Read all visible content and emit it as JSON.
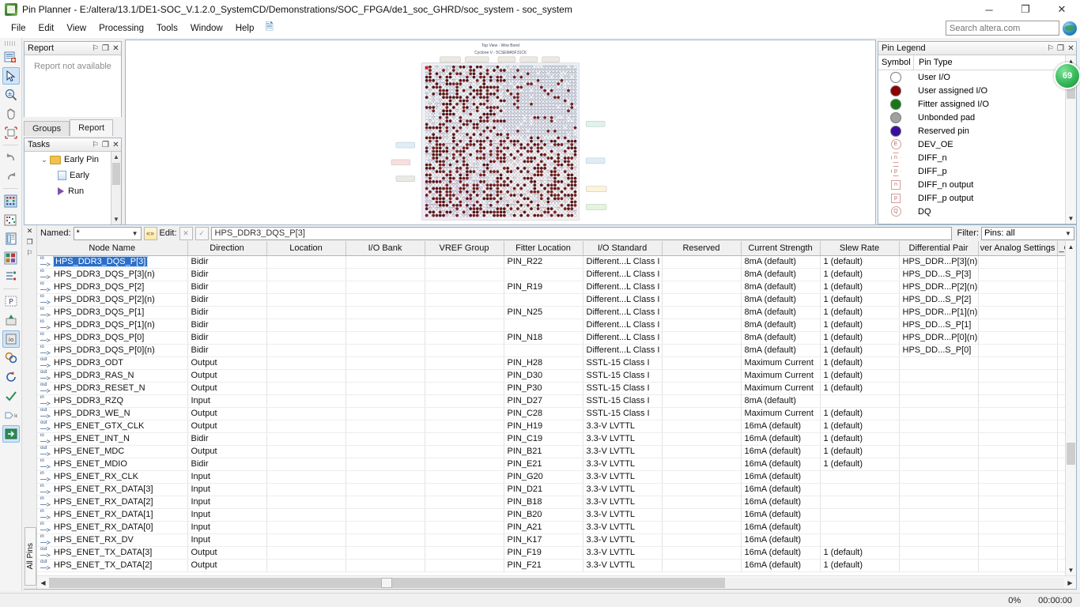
{
  "window": {
    "title": "Pin Planner - E:/altera/13.1/DE1-SOC_V.1.2.0_SystemCD/Demonstrations/SOC_FPGA/de1_soc_GHRD/soc_system - soc_system",
    "minimize": "─",
    "maximize": "❐",
    "close": "✕"
  },
  "menu": {
    "items": [
      "File",
      "Edit",
      "View",
      "Processing",
      "Tools",
      "Window",
      "Help"
    ],
    "note_icon": "notes-icon"
  },
  "search": {
    "placeholder": "Search altera.com",
    "value": "",
    "globe_icon": "globe-icon"
  },
  "left_toolbar": {
    "buttons": [
      {
        "name": "new-pin-report-icon"
      },
      {
        "name": "select-arrow-icon",
        "active": true
      },
      {
        "name": "zoom-icon"
      },
      {
        "name": "pan-hand-icon"
      },
      {
        "name": "zoom-fit-icon"
      },
      {
        "name": "undo-icon"
      },
      {
        "name": "redo-icon"
      },
      {
        "name": "package-view-icon"
      },
      {
        "name": "pad-view-icon"
      },
      {
        "name": "report-view-icon"
      },
      {
        "name": "resource-view-icon"
      },
      {
        "name": "tasks-view-icon"
      },
      {
        "name": "pin-legend-icon"
      },
      {
        "name": "highlight-icon"
      },
      {
        "name": "all-pins-view-icon",
        "active": true
      },
      {
        "name": "find-icon"
      },
      {
        "name": "refresh-icon"
      },
      {
        "name": "validate-icon"
      },
      {
        "name": "io-assignment-icon"
      },
      {
        "name": "export-icon",
        "active": true
      }
    ]
  },
  "report_panel": {
    "title": "Report",
    "message": "Report not available",
    "pin_icon": "⚐",
    "float_icon": "❐",
    "close_icon": "✕"
  },
  "dock_tabs": [
    {
      "label": "Groups",
      "selected": false
    },
    {
      "label": "Report",
      "selected": true
    }
  ],
  "tasks_panel": {
    "title": "Tasks",
    "pin_icon": "⚐",
    "float_icon": "❐",
    "close_icon": "✕",
    "tree": [
      {
        "label": "Early Pin",
        "icon": "folder-icon",
        "chevron": "⌄"
      },
      {
        "label": "Early",
        "icon": "page-icon",
        "chevron": ""
      },
      {
        "label": "Run ",
        "icon": "play-icon",
        "chevron": ""
      }
    ]
  },
  "chip_view": {
    "title_line1": "Top View - Wire Bond",
    "title_line2": "Cyclone V - 5CSEMA5F31C6"
  },
  "pin_legend": {
    "title": "Pin Legend",
    "pin_icon": "⚐",
    "float_icon": "❐",
    "close_icon": "✕",
    "headers": [
      "Symbol",
      "Pin Type"
    ],
    "rows": [
      {
        "label": "User I/O",
        "symbol": "circle",
        "color": "#ffffff",
        "glyph": ""
      },
      {
        "label": "User assigned I/O",
        "symbol": "circle",
        "color": "#8b0000",
        "glyph": ""
      },
      {
        "label": "Fitter assigned I/O",
        "symbol": "circle",
        "color": "#137a13",
        "glyph": ""
      },
      {
        "label": "Unbonded pad",
        "symbol": "circle",
        "color": "#a0a0a0",
        "glyph": ""
      },
      {
        "label": "Reserved pin",
        "symbol": "circle",
        "color": "#3a0d9e",
        "glyph": ""
      },
      {
        "label": "DEV_OE",
        "symbol": "circle-outline",
        "color": "#ffffff",
        "glyph": "E"
      },
      {
        "label": "DIFF_n",
        "symbol": "hex",
        "color": "#ffffff",
        "glyph": "n"
      },
      {
        "label": "DIFF_p",
        "symbol": "hex",
        "color": "#ffffff",
        "glyph": "p"
      },
      {
        "label": "DIFF_n output",
        "symbol": "square",
        "color": "#ffffff",
        "glyph": "n"
      },
      {
        "label": "DIFF_p output",
        "symbol": "square",
        "color": "#ffffff",
        "glyph": "p"
      },
      {
        "label": "DQ",
        "symbol": "circle-outline",
        "color": "#ffffff",
        "glyph": "Q"
      }
    ],
    "badge_value": "69"
  },
  "filter_bar": {
    "named_label": "Named:",
    "named_value": "*",
    "expand_icon": "«»",
    "edit_label": "Edit:",
    "cancel_icon": "✕",
    "accept_icon": "✓",
    "edit_value": "HPS_DDR3_DQS_P[3]",
    "filter_label": "Filter:",
    "filter_value": "Pins: all",
    "caret": "▼",
    "close_icon": "✕",
    "float_icon": "❐",
    "pin_icon": "⚐"
  },
  "pin_table": {
    "columns": [
      "Node Name",
      "Direction",
      "Location",
      "I/O Bank",
      "VREF Group",
      "Fitter Location",
      "I/O Standard",
      "Reserved",
      "Current Strength",
      "Slew Rate",
      "Differential Pair",
      "ver Analog Settings",
      "_GXB/VCC"
    ],
    "vertical_tab": "All Pins",
    "selected_row_index": 0,
    "rows": [
      {
        "icon": "io",
        "node": "HPS_DDR3_DQS_P[3]",
        "direction": "Bidir",
        "location": "",
        "bank": "",
        "vref": "",
        "fitter": "PIN_R22",
        "std": "Different...L Class I",
        "reserved": "",
        "current": "8mA (default)",
        "slew": "1 (default)",
        "diffpair": "HPS_DDR...P[3](n)",
        "analog": "",
        "gxb": ""
      },
      {
        "icon": "io",
        "node": "HPS_DDR3_DQS_P[3](n)",
        "direction": "Bidir",
        "location": "",
        "bank": "",
        "vref": "",
        "fitter": "",
        "std": "Different...L Class I",
        "reserved": "",
        "current": "8mA (default)",
        "slew": "1 (default)",
        "diffpair": "HPS_DD...S_P[3]",
        "analog": "",
        "gxb": ""
      },
      {
        "icon": "io",
        "node": "HPS_DDR3_DQS_P[2]",
        "direction": "Bidir",
        "location": "",
        "bank": "",
        "vref": "",
        "fitter": "PIN_R19",
        "std": "Different...L Class I",
        "reserved": "",
        "current": "8mA (default)",
        "slew": "1 (default)",
        "diffpair": "HPS_DDR...P[2](n)",
        "analog": "",
        "gxb": ""
      },
      {
        "icon": "io",
        "node": "HPS_DDR3_DQS_P[2](n)",
        "direction": "Bidir",
        "location": "",
        "bank": "",
        "vref": "",
        "fitter": "",
        "std": "Different...L Class I",
        "reserved": "",
        "current": "8mA (default)",
        "slew": "1 (default)",
        "diffpair": "HPS_DD...S_P[2]",
        "analog": "",
        "gxb": ""
      },
      {
        "icon": "io",
        "node": "HPS_DDR3_DQS_P[1]",
        "direction": "Bidir",
        "location": "",
        "bank": "",
        "vref": "",
        "fitter": "PIN_N25",
        "std": "Different...L Class I",
        "reserved": "",
        "current": "8mA (default)",
        "slew": "1 (default)",
        "diffpair": "HPS_DDR...P[1](n)",
        "analog": "",
        "gxb": ""
      },
      {
        "icon": "io",
        "node": "HPS_DDR3_DQS_P[1](n)",
        "direction": "Bidir",
        "location": "",
        "bank": "",
        "vref": "",
        "fitter": "",
        "std": "Different...L Class I",
        "reserved": "",
        "current": "8mA (default)",
        "slew": "1 (default)",
        "diffpair": "HPS_DD...S_P[1]",
        "analog": "",
        "gxb": ""
      },
      {
        "icon": "io",
        "node": "HPS_DDR3_DQS_P[0]",
        "direction": "Bidir",
        "location": "",
        "bank": "",
        "vref": "",
        "fitter": "PIN_N18",
        "std": "Different...L Class I",
        "reserved": "",
        "current": "8mA (default)",
        "slew": "1 (default)",
        "diffpair": "HPS_DDR...P[0](n)",
        "analog": "",
        "gxb": ""
      },
      {
        "icon": "io",
        "node": "HPS_DDR3_DQS_P[0](n)",
        "direction": "Bidir",
        "location": "",
        "bank": "",
        "vref": "",
        "fitter": "",
        "std": "Different...L Class I",
        "reserved": "",
        "current": "8mA (default)",
        "slew": "1 (default)",
        "diffpair": "HPS_DD...S_P[0]",
        "analog": "",
        "gxb": ""
      },
      {
        "icon": "out",
        "node": "HPS_DDR3_ODT",
        "direction": "Output",
        "location": "",
        "bank": "",
        "vref": "",
        "fitter": "PIN_H28",
        "std": "SSTL-15 Class I",
        "reserved": "",
        "current": "Maximum Current",
        "slew": "1 (default)",
        "diffpair": "",
        "analog": "",
        "gxb": ""
      },
      {
        "icon": "out",
        "node": "HPS_DDR3_RAS_N",
        "direction": "Output",
        "location": "",
        "bank": "",
        "vref": "",
        "fitter": "PIN_D30",
        "std": "SSTL-15 Class I",
        "reserved": "",
        "current": "Maximum Current",
        "slew": "1 (default)",
        "diffpair": "",
        "analog": "",
        "gxb": ""
      },
      {
        "icon": "out",
        "node": "HPS_DDR3_RESET_N",
        "direction": "Output",
        "location": "",
        "bank": "",
        "vref": "",
        "fitter": "PIN_P30",
        "std": "SSTL-15 Class I",
        "reserved": "",
        "current": "Maximum Current",
        "slew": "1 (default)",
        "diffpair": "",
        "analog": "",
        "gxb": ""
      },
      {
        "icon": "in",
        "node": "HPS_DDR3_RZQ",
        "direction": "Input",
        "location": "",
        "bank": "",
        "vref": "",
        "fitter": "PIN_D27",
        "std": "SSTL-15 Class I",
        "reserved": "",
        "current": "8mA (default)",
        "slew": "",
        "diffpair": "",
        "analog": "",
        "gxb": ""
      },
      {
        "icon": "out",
        "node": "HPS_DDR3_WE_N",
        "direction": "Output",
        "location": "",
        "bank": "",
        "vref": "",
        "fitter": "PIN_C28",
        "std": "SSTL-15 Class I",
        "reserved": "",
        "current": "Maximum Current",
        "slew": "1 (default)",
        "diffpair": "",
        "analog": "",
        "gxb": ""
      },
      {
        "icon": "out",
        "node": "HPS_ENET_GTX_CLK",
        "direction": "Output",
        "location": "",
        "bank": "",
        "vref": "",
        "fitter": "PIN_H19",
        "std": "3.3-V LVTTL",
        "reserved": "",
        "current": "16mA (default)",
        "slew": "1 (default)",
        "diffpair": "",
        "analog": "",
        "gxb": ""
      },
      {
        "icon": "io",
        "node": "HPS_ENET_INT_N",
        "direction": "Bidir",
        "location": "",
        "bank": "",
        "vref": "",
        "fitter": "PIN_C19",
        "std": "3.3-V LVTTL",
        "reserved": "",
        "current": "16mA (default)",
        "slew": "1 (default)",
        "diffpair": "",
        "analog": "",
        "gxb": ""
      },
      {
        "icon": "out",
        "node": "HPS_ENET_MDC",
        "direction": "Output",
        "location": "",
        "bank": "",
        "vref": "",
        "fitter": "PIN_B21",
        "std": "3.3-V LVTTL",
        "reserved": "",
        "current": "16mA (default)",
        "slew": "1 (default)",
        "diffpair": "",
        "analog": "",
        "gxb": ""
      },
      {
        "icon": "io",
        "node": "HPS_ENET_MDIO",
        "direction": "Bidir",
        "location": "",
        "bank": "",
        "vref": "",
        "fitter": "PIN_E21",
        "std": "3.3-V LVTTL",
        "reserved": "",
        "current": "16mA (default)",
        "slew": "1 (default)",
        "diffpair": "",
        "analog": "",
        "gxb": ""
      },
      {
        "icon": "in",
        "node": "HPS_ENET_RX_CLK",
        "direction": "Input",
        "location": "",
        "bank": "",
        "vref": "",
        "fitter": "PIN_G20",
        "std": "3.3-V LVTTL",
        "reserved": "",
        "current": "16mA (default)",
        "slew": "",
        "diffpair": "",
        "analog": "",
        "gxb": ""
      },
      {
        "icon": "in",
        "node": "HPS_ENET_RX_DATA[3]",
        "direction": "Input",
        "location": "",
        "bank": "",
        "vref": "",
        "fitter": "PIN_D21",
        "std": "3.3-V LVTTL",
        "reserved": "",
        "current": "16mA (default)",
        "slew": "",
        "diffpair": "",
        "analog": "",
        "gxb": ""
      },
      {
        "icon": "in",
        "node": "HPS_ENET_RX_DATA[2]",
        "direction": "Input",
        "location": "",
        "bank": "",
        "vref": "",
        "fitter": "PIN_B18",
        "std": "3.3-V LVTTL",
        "reserved": "",
        "current": "16mA (default)",
        "slew": "",
        "diffpair": "",
        "analog": "",
        "gxb": ""
      },
      {
        "icon": "in",
        "node": "HPS_ENET_RX_DATA[1]",
        "direction": "Input",
        "location": "",
        "bank": "",
        "vref": "",
        "fitter": "PIN_B20",
        "std": "3.3-V LVTTL",
        "reserved": "",
        "current": "16mA (default)",
        "slew": "",
        "diffpair": "",
        "analog": "",
        "gxb": ""
      },
      {
        "icon": "in",
        "node": "HPS_ENET_RX_DATA[0]",
        "direction": "Input",
        "location": "",
        "bank": "",
        "vref": "",
        "fitter": "PIN_A21",
        "std": "3.3-V LVTTL",
        "reserved": "",
        "current": "16mA (default)",
        "slew": "",
        "diffpair": "",
        "analog": "",
        "gxb": ""
      },
      {
        "icon": "in",
        "node": "HPS_ENET_RX_DV",
        "direction": "Input",
        "location": "",
        "bank": "",
        "vref": "",
        "fitter": "PIN_K17",
        "std": "3.3-V LVTTL",
        "reserved": "",
        "current": "16mA (default)",
        "slew": "",
        "diffpair": "",
        "analog": "",
        "gxb": ""
      },
      {
        "icon": "out",
        "node": "HPS_ENET_TX_DATA[3]",
        "direction": "Output",
        "location": "",
        "bank": "",
        "vref": "",
        "fitter": "PIN_F19",
        "std": "3.3-V LVTTL",
        "reserved": "",
        "current": "16mA (default)",
        "slew": "1 (default)",
        "diffpair": "",
        "analog": "",
        "gxb": ""
      },
      {
        "icon": "out",
        "node": "HPS_ENET_TX_DATA[2]",
        "direction": "Output",
        "location": "",
        "bank": "",
        "vref": "",
        "fitter": "PIN_F21",
        "std": "3.3-V LVTTL",
        "reserved": "",
        "current": "16mA (default)",
        "slew": "1 (default)",
        "diffpair": "",
        "analog": "",
        "gxb": ""
      }
    ]
  },
  "status_bar": {
    "progress": "0%",
    "elapsed": "00:00:00"
  }
}
